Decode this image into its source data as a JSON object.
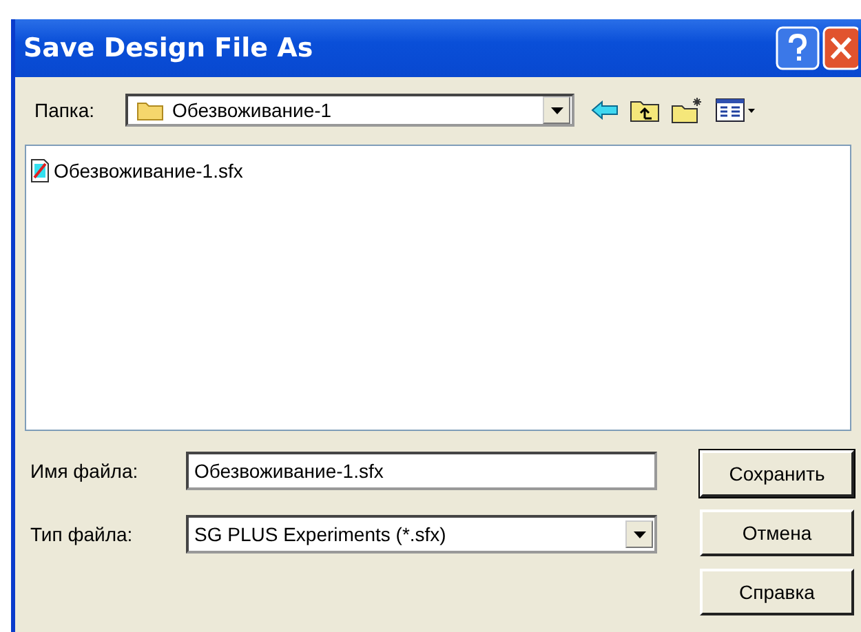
{
  "window": {
    "title": "Save Design File As"
  },
  "folder": {
    "label": "Папка:",
    "value": "Обезвоживание-1"
  },
  "files": [
    {
      "name": "Обезвоживание-1.sfx"
    }
  ],
  "file_name": {
    "label": "Имя файла:",
    "value": "Обезвоживание-1.sfx"
  },
  "file_type": {
    "label": "Тип файла:",
    "value": "SG PLUS Experiments (*.sfx)"
  },
  "buttons": [
    {
      "label": "Сохранить",
      "default": true
    },
    {
      "label": "Отмена",
      "default": false
    },
    {
      "label": "Справка",
      "default": false
    }
  ]
}
